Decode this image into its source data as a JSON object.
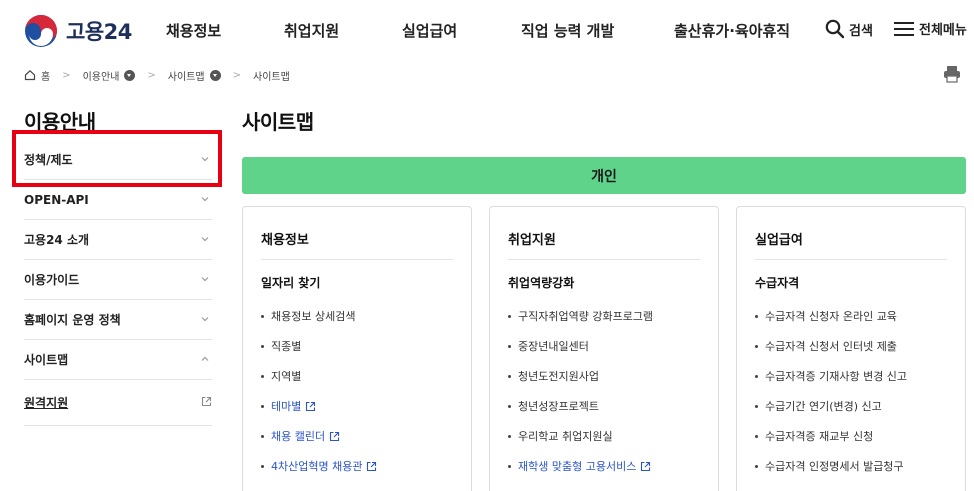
{
  "header": {
    "logo_text": "고용24",
    "nav": [
      "채용정보",
      "취업지원",
      "실업급여",
      "직업 능력 개발",
      "출산휴가·육아휴직"
    ],
    "search_label": "검색",
    "menu_label": "전체메뉴"
  },
  "breadcrumb": [
    "홈",
    "이용안내",
    "사이트맵",
    "사이트맵"
  ],
  "sidebar": {
    "title": "이용안내",
    "items": [
      {
        "label": "정책/제도",
        "state": "collapsed"
      },
      {
        "label": "OPEN-API",
        "state": "collapsed"
      },
      {
        "label": "고용24 소개",
        "state": "collapsed"
      },
      {
        "label": "이용가이드",
        "state": "collapsed"
      },
      {
        "label": "홈페이지 운영 정책",
        "state": "collapsed"
      },
      {
        "label": "사이트맵",
        "state": "expanded"
      },
      {
        "label": "원격지원",
        "state": "external"
      }
    ]
  },
  "main": {
    "title": "사이트맵",
    "category": "개인",
    "cards": [
      {
        "title": "채용정보",
        "subtitle": "일자리 찾기",
        "links": [
          {
            "label": "채용정보 상세검색",
            "external": false
          },
          {
            "label": "직종별",
            "external": false
          },
          {
            "label": "지역별",
            "external": false
          },
          {
            "label": "테마별",
            "external": true
          },
          {
            "label": "채용 캘린더",
            "external": true
          },
          {
            "label": "4차산업혁명 채용관",
            "external": true
          }
        ]
      },
      {
        "title": "취업지원",
        "subtitle": "취업역량강화",
        "links": [
          {
            "label": "구직자취업역량 강화프로그램",
            "external": false
          },
          {
            "label": "중장년내일센터",
            "external": false
          },
          {
            "label": "청년도전지원사업",
            "external": false
          },
          {
            "label": "청년성장프로젝트",
            "external": false
          },
          {
            "label": "우리학교 취업지원실",
            "external": false
          },
          {
            "label": "재학생 맞춤형 고용서비스",
            "external": true
          }
        ]
      },
      {
        "title": "실업급여",
        "subtitle": "수급자격",
        "links": [
          {
            "label": "수급자격 신청자 온라인 교육",
            "external": false
          },
          {
            "label": "수급자격 신청서 인터넷 제출",
            "external": false
          },
          {
            "label": "수급자격증 기재사항 변경 신고",
            "external": false
          },
          {
            "label": "수급기간 연기(변경) 신고",
            "external": false
          },
          {
            "label": "수급자격증 재교부 신청",
            "external": false
          },
          {
            "label": "수급자격 인정명세서 발급청구",
            "external": false
          }
        ]
      }
    ]
  },
  "colors": {
    "accent_green": "#5fd38a",
    "link_blue": "#2a55c9",
    "highlight_red": "#e60012",
    "logo_blue": "#1f4fa0",
    "logo_red": "#d6283a"
  }
}
